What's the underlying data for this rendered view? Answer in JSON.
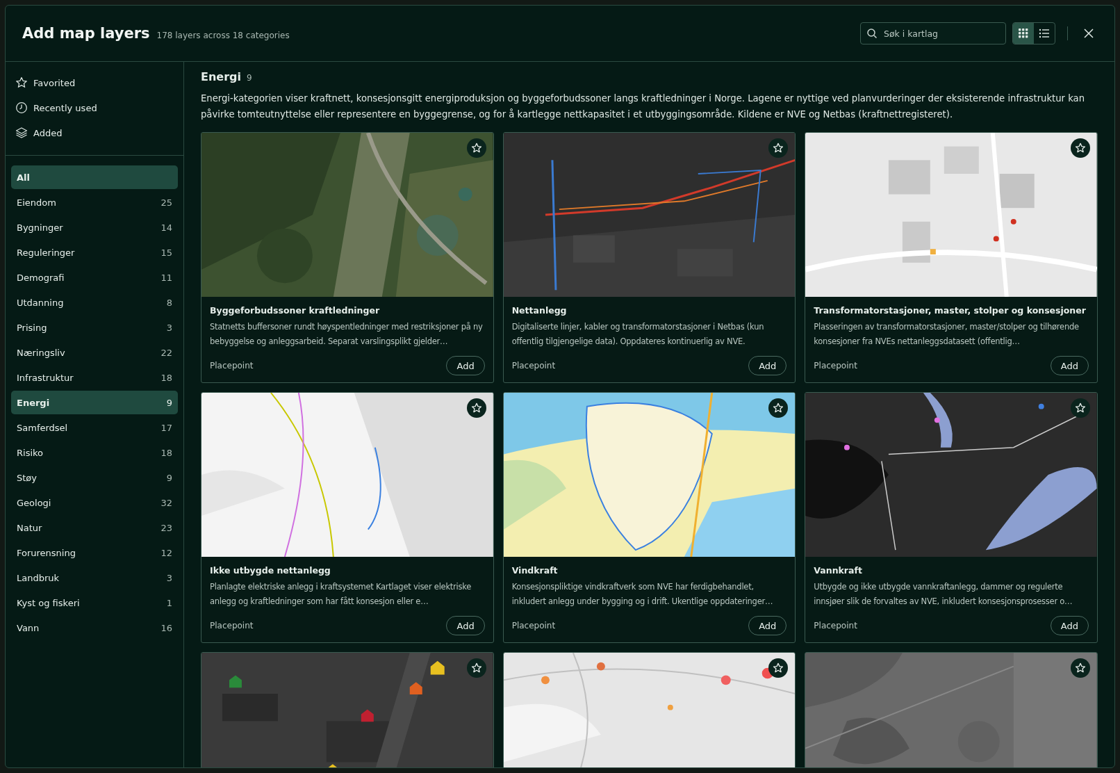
{
  "header": {
    "title": "Add map layers",
    "subtitle": "178 layers across 18 categories",
    "search": {
      "placeholder": "Søk i kartlag"
    },
    "views": [
      {
        "kind": "grid",
        "selected": true
      },
      {
        "kind": "list",
        "selected": false
      }
    ]
  },
  "sidebar": {
    "quick": [
      {
        "kind": "star",
        "label": "Favorited"
      },
      {
        "kind": "clock",
        "label": "Recently used"
      },
      {
        "kind": "layers",
        "label": "Added"
      }
    ],
    "categories": [
      {
        "label": "All",
        "selected": true
      },
      {
        "label": "Eiendom",
        "count": "25",
        "selected": false
      },
      {
        "label": "Bygninger",
        "count": "14",
        "selected": false
      },
      {
        "label": "Reguleringer",
        "count": "15",
        "selected": false
      },
      {
        "label": "Demografi",
        "count": "11",
        "selected": false
      },
      {
        "label": "Utdanning",
        "count": "8",
        "selected": false
      },
      {
        "label": "Prising",
        "count": "3",
        "selected": false
      },
      {
        "label": "Næringsliv",
        "count": "22",
        "selected": false
      },
      {
        "label": "Infrastruktur",
        "count": "18",
        "selected": false
      },
      {
        "label": "Energi",
        "count": "9",
        "selected": true
      },
      {
        "label": "Samferdsel",
        "count": "17",
        "selected": false
      },
      {
        "label": "Risiko",
        "count": "18",
        "selected": false
      },
      {
        "label": "Støy",
        "count": "9",
        "selected": false
      },
      {
        "label": "Geologi",
        "count": "32",
        "selected": false
      },
      {
        "label": "Natur",
        "count": "23",
        "selected": false
      },
      {
        "label": "Forurensning",
        "count": "12",
        "selected": false
      },
      {
        "label": "Landbruk",
        "count": "3",
        "selected": false
      },
      {
        "label": "Kyst og fiskeri",
        "count": "1",
        "selected": false
      },
      {
        "label": "Vann",
        "count": "16",
        "selected": false
      }
    ]
  },
  "main": {
    "title": "Energi",
    "count": "9",
    "description": "Energi-kategorien viser kraftnett, konsesjonsgitt energiproduksjon og byggeforbudssoner langs kraftledninger i Norge. Lagene er nyttige ved planvurderinger der eksisterende infrastruktur kan påvirke tomteutnyttelse eller representere en byggegrense, og for å kartlegge nettkapasitet i et utbyggingsområde. Kildene er NVE og Netbas (kraftnettregisteret).",
    "cards": [
      {
        "kind": "layer",
        "title": "Byggeforbudssoner kraftledninger",
        "description": "Statnetts buffersoner rundt høyspentledninger med restriksjoner på ny bebyggelse og anleggsarbeid. Separat varslingsplikt gjelder…",
        "source": "Placepoint",
        "button": "Add"
      },
      {
        "kind": "layer",
        "title": "Nettanlegg",
        "description": "Digitaliserte linjer, kabler og transformatorstasjoner i Netbas (kun offentlig tilgjengelige data). Oppdateres kontinuerlig av NVE.",
        "source": "Placepoint",
        "button": "Add"
      },
      {
        "kind": "layer",
        "title": "Transformatorstasjoner, master, stolper og konsesjoner",
        "description": "Plasseringen av transformatorstasjoner, master/stolper og tilhørende konsesjoner fra NVEs nettanleggsdatasett (offentlig…",
        "source": "Placepoint",
        "button": "Add"
      },
      {
        "kind": "layer",
        "title": "Ikke utbygde nettanlegg",
        "description": "Planlagte elektriske anlegg i kraftsystemet Kartlaget viser elektriske anlegg og kraftledninger som har fått konsesjon eller e…",
        "source": "Placepoint",
        "button": "Add"
      },
      {
        "kind": "layer",
        "title": "Vindkraft",
        "description": "Konsesjonspliktige vindkraftverk som NVE har ferdigbehandlet, inkludert anlegg under bygging og i drift. Ukentlige oppdateringer…",
        "source": "Placepoint",
        "button": "Add"
      },
      {
        "kind": "layer",
        "title": "Vannkraft",
        "description": "Utbygde og ikke utbygde vannkraftanlegg, dammer og regulerte innsjøer slik de forvaltes av NVE, inkludert konsesjonsprosesser o…",
        "source": "Placepoint",
        "button": "Add"
      },
      {
        "kind": "picture"
      },
      {
        "kind": "picture"
      },
      {
        "kind": "picture"
      }
    ]
  }
}
